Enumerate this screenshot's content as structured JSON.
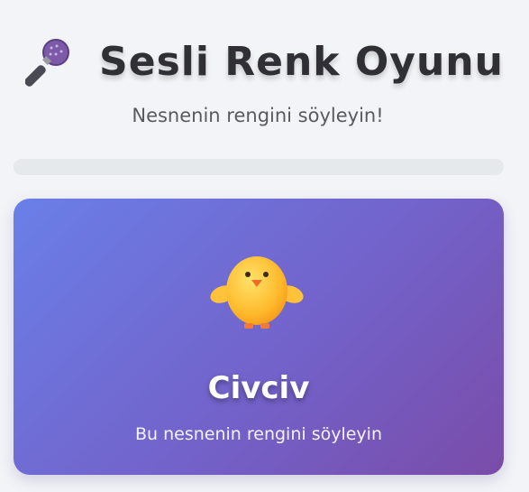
{
  "header": {
    "title": "Sesli Renk Oyunu",
    "subtitle": "Nesnenin rengini söyleyin!"
  },
  "icons": {
    "title_icon": "microphone-icon",
    "object_icon": "chick-icon"
  },
  "progress": {
    "value_percent": 0
  },
  "card": {
    "object_name": "Civciv",
    "instruction": "Bu nesnenin rengini söyleyin"
  },
  "colors": {
    "page_background": "#f3f4f8",
    "card_gradient_start": "#6a7fe8",
    "card_gradient_end": "#7a4ca8",
    "progress_track": "#e6e9ec"
  }
}
